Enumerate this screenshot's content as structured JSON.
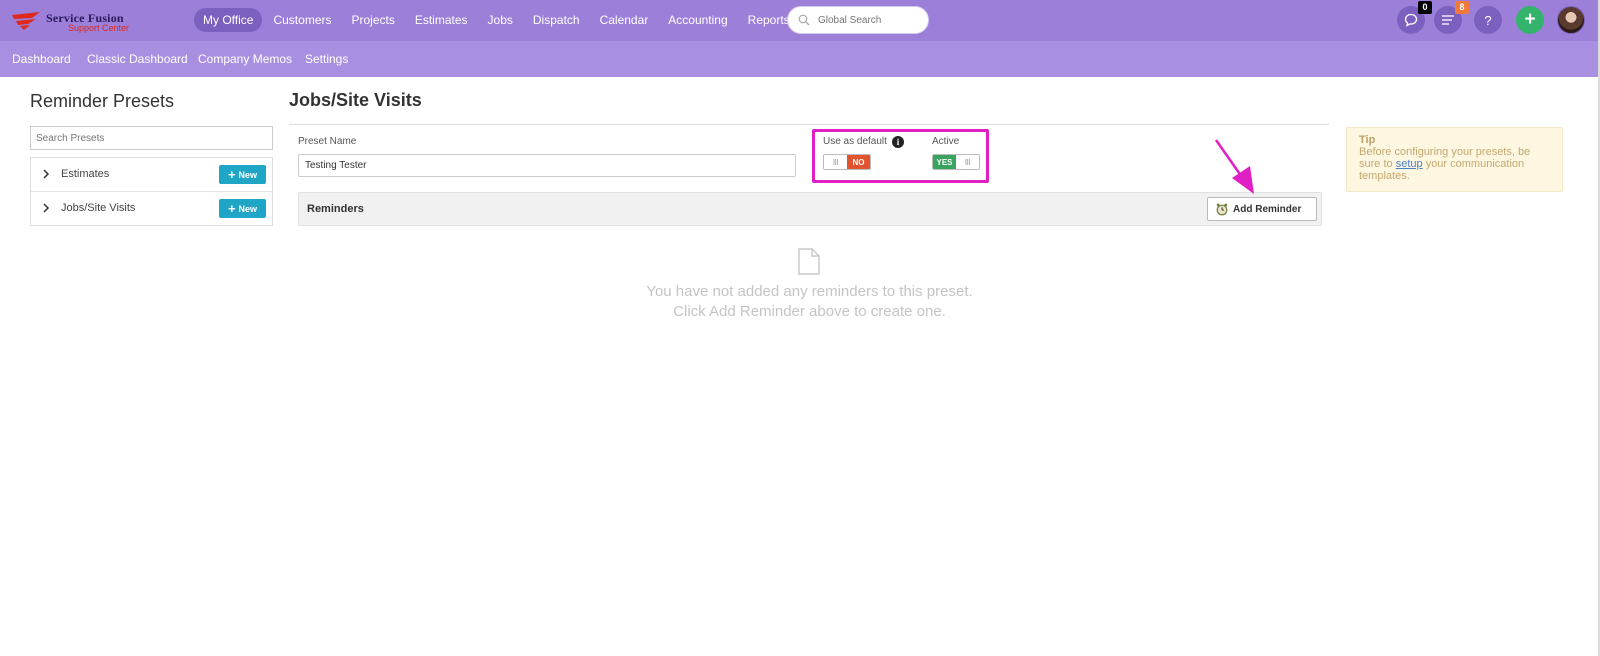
{
  "app": {
    "brand_name": "Service Fusion",
    "brand_sub": "Support Center",
    "brand_color": "#9b7fd8"
  },
  "topnav": {
    "items": [
      {
        "label": "My Office",
        "active": true
      },
      {
        "label": "Customers"
      },
      {
        "label": "Projects"
      },
      {
        "label": "Estimates"
      },
      {
        "label": "Jobs"
      },
      {
        "label": "Dispatch"
      },
      {
        "label": "Calendar"
      },
      {
        "label": "Accounting"
      },
      {
        "label": "Reports"
      }
    ],
    "search_placeholder": "Global Search",
    "chat_badge": "0",
    "tasks_badge": "8",
    "help_label": "?",
    "add_label": "+"
  },
  "subnav": {
    "items": [
      "Dashboard",
      "Classic Dashboard",
      "Company Memos",
      "Settings"
    ]
  },
  "sidebar": {
    "title": "Reminder Presets",
    "search_placeholder": "Search Presets",
    "presets": [
      {
        "label": "Estimates",
        "button": "New"
      },
      {
        "label": "Jobs/Site Visits",
        "button": "New"
      }
    ]
  },
  "main": {
    "title": "Jobs/Site Visits",
    "preset_name_label": "Preset Name",
    "preset_name_value": "Testing Tester",
    "default_label": "Use as default",
    "default_value": "NO",
    "active_label": "Active",
    "active_value": "YES",
    "toggle_grip": "III",
    "reminders_label": "Reminders",
    "add_reminder_label": "Add Reminder",
    "empty_line1": "You have not added any reminders to this preset.",
    "empty_line2": "Click Add Reminder above to create one."
  },
  "tip": {
    "title": "Tip",
    "text_before": "Before configuring your presets, be sure to",
    "link": "setup",
    "text_after": "your communication templates."
  },
  "colors": {
    "highlight": "#e020c4",
    "no": "#e2532f",
    "yes": "#3aa45f",
    "new_button": "#1fa6c6"
  }
}
